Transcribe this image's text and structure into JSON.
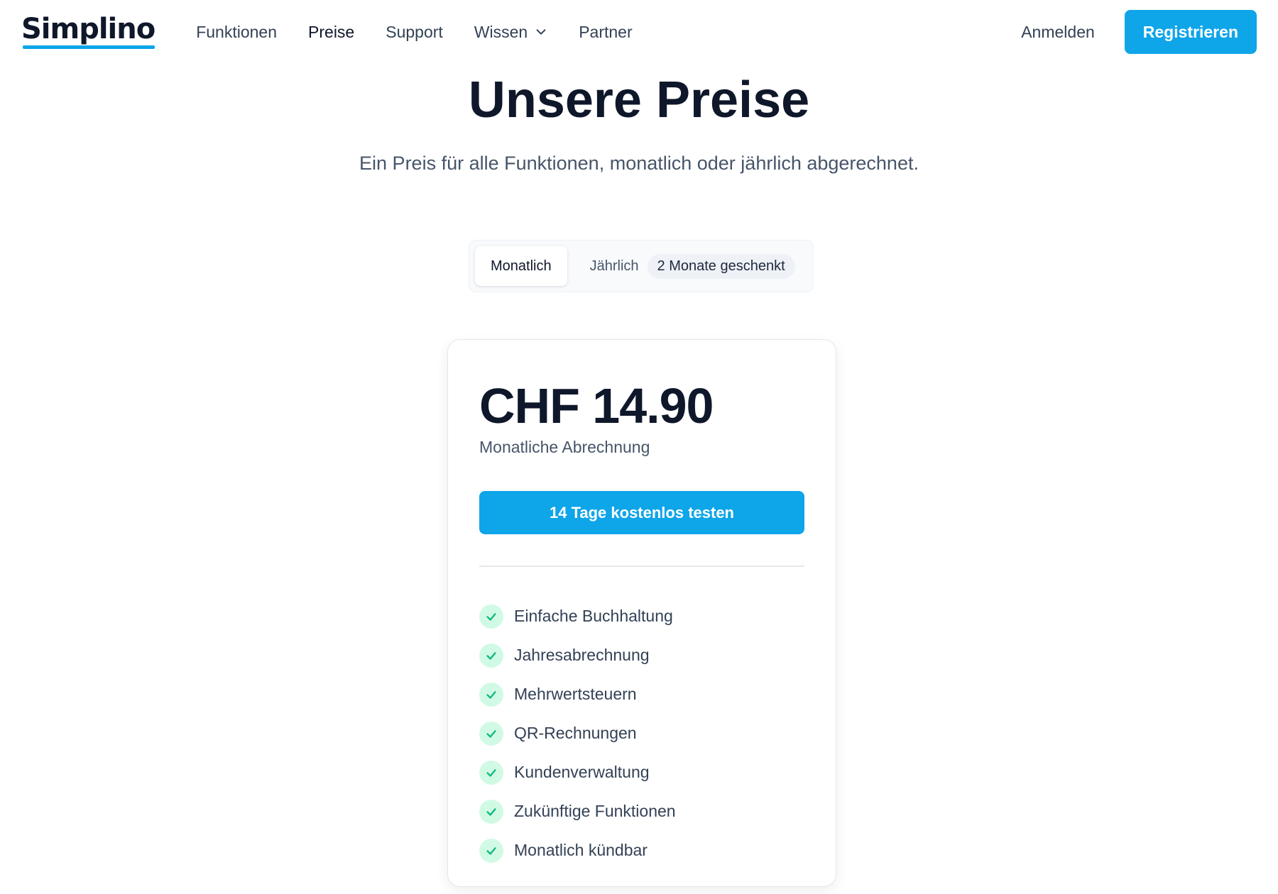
{
  "header": {
    "logo": "Simplino",
    "nav": [
      {
        "label": "Funktionen"
      },
      {
        "label": "Preise"
      },
      {
        "label": "Support"
      },
      {
        "label": "Wissen"
      },
      {
        "label": "Partner"
      }
    ],
    "login_label": "Anmelden",
    "register_label": "Registrieren"
  },
  "hero": {
    "title": "Unsere Preise",
    "subtitle": "Ein Preis für alle Funktionen, monatlich oder jährlich abgerechnet."
  },
  "billing_toggle": {
    "monthly_label": "Monatlich",
    "yearly_label": "Jährlich",
    "promo_badge": "2 Monate geschenkt",
    "selected": "Monatlich"
  },
  "plan": {
    "price": "CHF 14.90",
    "billing_note": "Monatliche Abrechnung",
    "cta_label": "14 Tage kostenlos testen",
    "features": [
      {
        "label": "Einfache Buchhaltung",
        "icon": "check-icon"
      },
      {
        "label": "Jahresabrechnung",
        "icon": "check-icon"
      },
      {
        "label": "Mehrwertsteuern",
        "icon": "check-icon"
      },
      {
        "label": "QR-Rechnungen",
        "icon": "check-icon"
      },
      {
        "label": "Kundenverwaltung",
        "icon": "check-icon"
      },
      {
        "label": "Zukünftige Funktionen",
        "icon": "check-icon"
      },
      {
        "label": "Monatlich kündbar",
        "icon": "check-icon"
      }
    ]
  },
  "colors": {
    "accent": "#0ea5e9",
    "text": "#0f172a",
    "muted": "#475569",
    "check_bg": "#d1fae5",
    "check_mark": "#10b981"
  }
}
